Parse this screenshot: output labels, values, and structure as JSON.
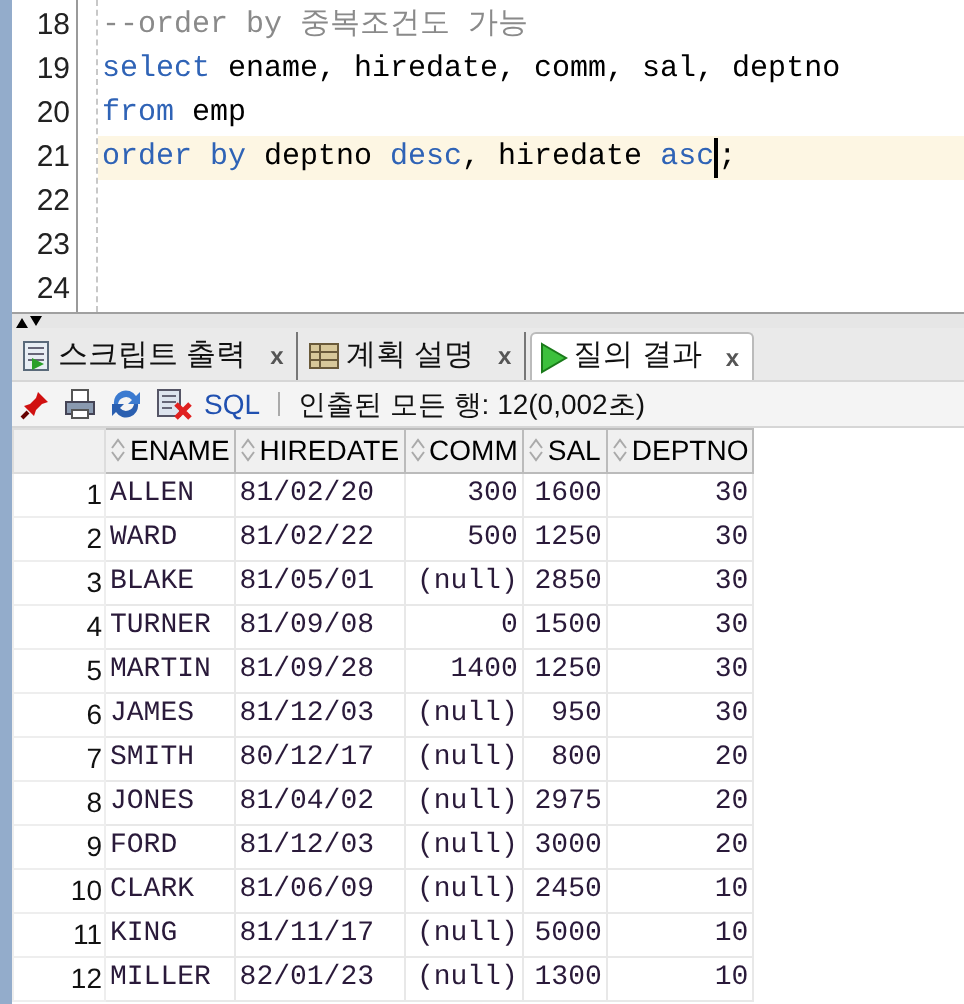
{
  "editor": {
    "lines": [
      {
        "number": "18",
        "current": false,
        "tokens": [
          {
            "kind": "comment",
            "text": "--order by 중복조건도 가능"
          }
        ]
      },
      {
        "number": "19",
        "current": false,
        "tokens": [
          {
            "kind": "keyword",
            "text": "select"
          },
          {
            "kind": "ident",
            "text": " ename, hiredate, comm, sal, deptno"
          }
        ]
      },
      {
        "number": "20",
        "current": false,
        "tokens": [
          {
            "kind": "keyword",
            "text": "from"
          },
          {
            "kind": "ident",
            "text": " emp"
          }
        ]
      },
      {
        "number": "21",
        "current": true,
        "tokens": [
          {
            "kind": "keyword",
            "text": "order by"
          },
          {
            "kind": "ident",
            "text": " deptno "
          },
          {
            "kind": "keyword",
            "text": "desc"
          },
          {
            "kind": "ident",
            "text": ", hiredate "
          },
          {
            "kind": "keyword",
            "text": "asc"
          },
          {
            "kind": "ident",
            "text": ";",
            "cursor": true
          }
        ]
      },
      {
        "number": "22",
        "current": false
      },
      {
        "number": "23",
        "current": false
      },
      {
        "number": "24",
        "current": false
      }
    ]
  },
  "tabs": [
    {
      "label": "스크립트 출력",
      "kind": "script",
      "selected": false,
      "close": "x"
    },
    {
      "label": "계획 설명",
      "kind": "plan",
      "selected": false,
      "close": "x"
    },
    {
      "label": "질의 결과",
      "kind": "run",
      "selected": true,
      "close": "x"
    }
  ],
  "toolbar": {
    "sql_link": "SQL",
    "status": "인출된 모든 행: 12(0,002초)"
  },
  "table": {
    "columns": [
      {
        "label": "ENAME"
      },
      {
        "label": "HIREDATE"
      },
      {
        "label": "COMM"
      },
      {
        "label": "SAL"
      },
      {
        "label": "DEPTNO"
      }
    ],
    "rows": [
      {
        "n": "1",
        "cells": [
          "ALLEN",
          "81/02/20",
          "300",
          "1600",
          "30"
        ]
      },
      {
        "n": "2",
        "cells": [
          "WARD",
          "81/02/22",
          "500",
          "1250",
          "30"
        ]
      },
      {
        "n": "3",
        "cells": [
          "BLAKE",
          "81/05/01",
          "(null)",
          "2850",
          "30"
        ]
      },
      {
        "n": "4",
        "cells": [
          "TURNER",
          "81/09/08",
          "0",
          "1500",
          "30"
        ]
      },
      {
        "n": "5",
        "cells": [
          "MARTIN",
          "81/09/28",
          "1400",
          "1250",
          "30"
        ]
      },
      {
        "n": "6",
        "cells": [
          "JAMES",
          "81/12/03",
          "(null)",
          "950",
          "30"
        ]
      },
      {
        "n": "7",
        "cells": [
          "SMITH",
          "80/12/17",
          "(null)",
          "800",
          "20"
        ]
      },
      {
        "n": "8",
        "cells": [
          "JONES",
          "81/04/02",
          "(null)",
          "2975",
          "20"
        ]
      },
      {
        "n": "9",
        "cells": [
          "FORD",
          "81/12/03",
          "(null)",
          "3000",
          "20"
        ]
      },
      {
        "n": "10",
        "cells": [
          "CLARK",
          "81/06/09",
          "(null)",
          "2450",
          "10"
        ]
      },
      {
        "n": "11",
        "cells": [
          "KING",
          "81/11/17",
          "(null)",
          "5000",
          "10"
        ]
      },
      {
        "n": "12",
        "cells": [
          "MILLER",
          "82/01/23",
          "(null)",
          "1300",
          "10"
        ]
      }
    ]
  }
}
